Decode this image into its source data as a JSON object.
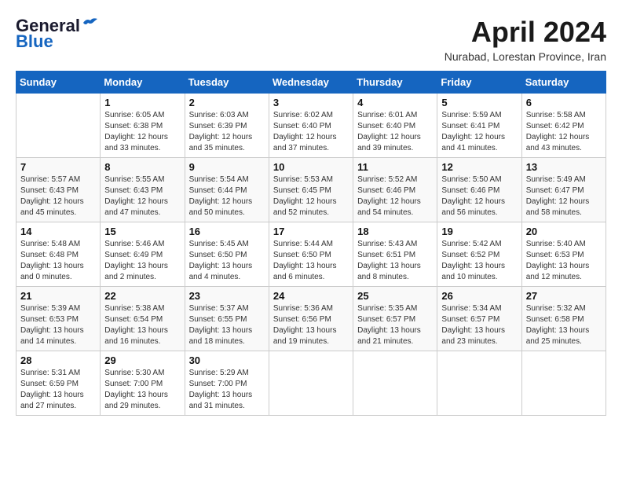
{
  "logo": {
    "general": "General",
    "blue": "Blue"
  },
  "title": "April 2024",
  "location": "Nurabad, Lorestan Province, Iran",
  "days_of_week": [
    "Sunday",
    "Monday",
    "Tuesday",
    "Wednesday",
    "Thursday",
    "Friday",
    "Saturday"
  ],
  "weeks": [
    [
      {
        "day": "",
        "info": ""
      },
      {
        "day": "1",
        "info": "Sunrise: 6:05 AM\nSunset: 6:38 PM\nDaylight: 12 hours\nand 33 minutes."
      },
      {
        "day": "2",
        "info": "Sunrise: 6:03 AM\nSunset: 6:39 PM\nDaylight: 12 hours\nand 35 minutes."
      },
      {
        "day": "3",
        "info": "Sunrise: 6:02 AM\nSunset: 6:40 PM\nDaylight: 12 hours\nand 37 minutes."
      },
      {
        "day": "4",
        "info": "Sunrise: 6:01 AM\nSunset: 6:40 PM\nDaylight: 12 hours\nand 39 minutes."
      },
      {
        "day": "5",
        "info": "Sunrise: 5:59 AM\nSunset: 6:41 PM\nDaylight: 12 hours\nand 41 minutes."
      },
      {
        "day": "6",
        "info": "Sunrise: 5:58 AM\nSunset: 6:42 PM\nDaylight: 12 hours\nand 43 minutes."
      }
    ],
    [
      {
        "day": "7",
        "info": "Sunrise: 5:57 AM\nSunset: 6:43 PM\nDaylight: 12 hours\nand 45 minutes."
      },
      {
        "day": "8",
        "info": "Sunrise: 5:55 AM\nSunset: 6:43 PM\nDaylight: 12 hours\nand 47 minutes."
      },
      {
        "day": "9",
        "info": "Sunrise: 5:54 AM\nSunset: 6:44 PM\nDaylight: 12 hours\nand 50 minutes."
      },
      {
        "day": "10",
        "info": "Sunrise: 5:53 AM\nSunset: 6:45 PM\nDaylight: 12 hours\nand 52 minutes."
      },
      {
        "day": "11",
        "info": "Sunrise: 5:52 AM\nSunset: 6:46 PM\nDaylight: 12 hours\nand 54 minutes."
      },
      {
        "day": "12",
        "info": "Sunrise: 5:50 AM\nSunset: 6:46 PM\nDaylight: 12 hours\nand 56 minutes."
      },
      {
        "day": "13",
        "info": "Sunrise: 5:49 AM\nSunset: 6:47 PM\nDaylight: 12 hours\nand 58 minutes."
      }
    ],
    [
      {
        "day": "14",
        "info": "Sunrise: 5:48 AM\nSunset: 6:48 PM\nDaylight: 13 hours\nand 0 minutes."
      },
      {
        "day": "15",
        "info": "Sunrise: 5:46 AM\nSunset: 6:49 PM\nDaylight: 13 hours\nand 2 minutes."
      },
      {
        "day": "16",
        "info": "Sunrise: 5:45 AM\nSunset: 6:50 PM\nDaylight: 13 hours\nand 4 minutes."
      },
      {
        "day": "17",
        "info": "Sunrise: 5:44 AM\nSunset: 6:50 PM\nDaylight: 13 hours\nand 6 minutes."
      },
      {
        "day": "18",
        "info": "Sunrise: 5:43 AM\nSunset: 6:51 PM\nDaylight: 13 hours\nand 8 minutes."
      },
      {
        "day": "19",
        "info": "Sunrise: 5:42 AM\nSunset: 6:52 PM\nDaylight: 13 hours\nand 10 minutes."
      },
      {
        "day": "20",
        "info": "Sunrise: 5:40 AM\nSunset: 6:53 PM\nDaylight: 13 hours\nand 12 minutes."
      }
    ],
    [
      {
        "day": "21",
        "info": "Sunrise: 5:39 AM\nSunset: 6:53 PM\nDaylight: 13 hours\nand 14 minutes."
      },
      {
        "day": "22",
        "info": "Sunrise: 5:38 AM\nSunset: 6:54 PM\nDaylight: 13 hours\nand 16 minutes."
      },
      {
        "day": "23",
        "info": "Sunrise: 5:37 AM\nSunset: 6:55 PM\nDaylight: 13 hours\nand 18 minutes."
      },
      {
        "day": "24",
        "info": "Sunrise: 5:36 AM\nSunset: 6:56 PM\nDaylight: 13 hours\nand 19 minutes."
      },
      {
        "day": "25",
        "info": "Sunrise: 5:35 AM\nSunset: 6:57 PM\nDaylight: 13 hours\nand 21 minutes."
      },
      {
        "day": "26",
        "info": "Sunrise: 5:34 AM\nSunset: 6:57 PM\nDaylight: 13 hours\nand 23 minutes."
      },
      {
        "day": "27",
        "info": "Sunrise: 5:32 AM\nSunset: 6:58 PM\nDaylight: 13 hours\nand 25 minutes."
      }
    ],
    [
      {
        "day": "28",
        "info": "Sunrise: 5:31 AM\nSunset: 6:59 PM\nDaylight: 13 hours\nand 27 minutes."
      },
      {
        "day": "29",
        "info": "Sunrise: 5:30 AM\nSunset: 7:00 PM\nDaylight: 13 hours\nand 29 minutes."
      },
      {
        "day": "30",
        "info": "Sunrise: 5:29 AM\nSunset: 7:00 PM\nDaylight: 13 hours\nand 31 minutes."
      },
      {
        "day": "",
        "info": ""
      },
      {
        "day": "",
        "info": ""
      },
      {
        "day": "",
        "info": ""
      },
      {
        "day": "",
        "info": ""
      }
    ]
  ]
}
